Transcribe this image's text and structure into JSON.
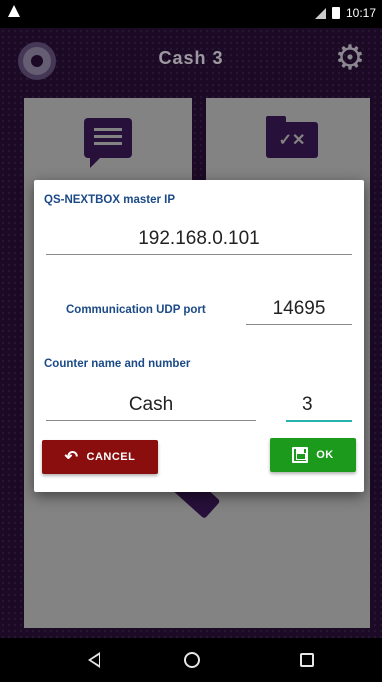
{
  "status_bar": {
    "time": "10:17"
  },
  "app": {
    "title": "Cash 3"
  },
  "tiles": {
    "tile1_icon": "message-icon",
    "tile2_icon": "folder-check-x-icon",
    "tile2_symbol": "✓✕",
    "main_icon": "wrench-icon"
  },
  "dialog": {
    "master_ip_label": "QS-NEXTBOX master IP",
    "master_ip_value": "192.168.0.101",
    "udp_port_label": "Communication UDP port",
    "udp_port_value": "14695",
    "counter_label": "Counter name and number",
    "counter_name_value": "Cash",
    "counter_number_value": "3",
    "cancel_label": "CANCEL",
    "ok_label": "OK"
  },
  "colors": {
    "accent_purple": "#3c1a59",
    "label_blue": "#1b4a86",
    "cancel_red": "#8b0e0e",
    "ok_green": "#1c9a1c",
    "focus_teal": "#26b3b0"
  }
}
